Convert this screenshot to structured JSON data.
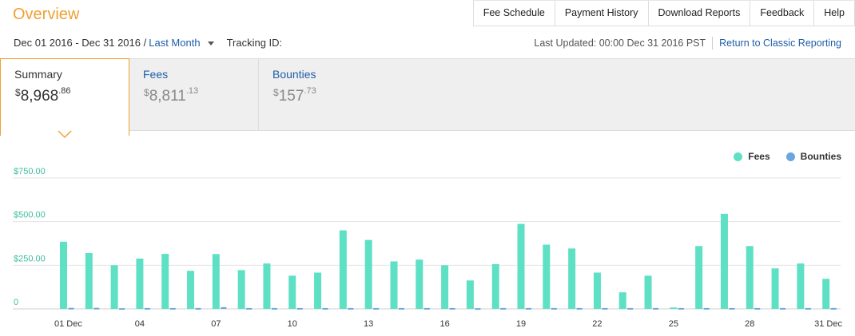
{
  "header": {
    "title": "Overview",
    "nav": [
      "Fee Schedule",
      "Payment History",
      "Download Reports",
      "Feedback",
      "Help"
    ]
  },
  "filters": {
    "date_range": "Dec 01 2016 - Dec 31 2016 /",
    "period": "Last Month",
    "tracking_label": "Tracking ID:",
    "last_updated": "Last Updated: 00:00 Dec 31 2016 PST",
    "classic_link": "Return to Classic Reporting"
  },
  "tabs": [
    {
      "label": "Summary",
      "currency": "$",
      "whole": "8,968",
      "cents": ".86"
    },
    {
      "label": "Fees",
      "currency": "$",
      "whole": "8,811",
      "cents": ".13"
    },
    {
      "label": "Bounties",
      "currency": "$",
      "whole": "157",
      "cents": ".73"
    }
  ],
  "colors": {
    "fees": "#5ee0c4",
    "bounties": "#6aa7e0",
    "accent": "#f0a030",
    "link": "#1f5ea8"
  },
  "chart_data": {
    "type": "bar",
    "categories": [
      "01 Dec",
      "02",
      "03",
      "04",
      "05",
      "06",
      "07",
      "08",
      "09",
      "10",
      "11",
      "12",
      "13",
      "14",
      "15",
      "16",
      "17",
      "18",
      "19",
      "20",
      "21",
      "22",
      "23",
      "24",
      "25",
      "26",
      "27",
      "28",
      "29",
      "30",
      "31 Dec"
    ],
    "x_tick_labels": [
      "01 Dec",
      "04",
      "07",
      "10",
      "13",
      "16",
      "19",
      "22",
      "25",
      "28",
      "31 Dec"
    ],
    "y_tick_labels": [
      "0",
      "$250.00",
      "$500.00",
      "$750.00"
    ],
    "ylim": [
      0,
      750
    ],
    "legend": [
      "Fees",
      "Bounties"
    ],
    "legend_position": "top-right",
    "series": [
      {
        "name": "Fees",
        "values": [
          385,
          320,
          250,
          288,
          315,
          218,
          314,
          222,
          260,
          190,
          208,
          450,
          395,
          272,
          282,
          250,
          163,
          256,
          487,
          368,
          346,
          208,
          95,
          190,
          8,
          360,
          545,
          360,
          232,
          260,
          172
        ]
      },
      {
        "name": "Bounties",
        "values": [
          6,
          6,
          4,
          5,
          5,
          5,
          10,
          5,
          5,
          5,
          5,
          5,
          5,
          5,
          5,
          5,
          4,
          5,
          5,
          5,
          5,
          5,
          5,
          5,
          5,
          5,
          5,
          5,
          5,
          5,
          5
        ]
      }
    ]
  }
}
